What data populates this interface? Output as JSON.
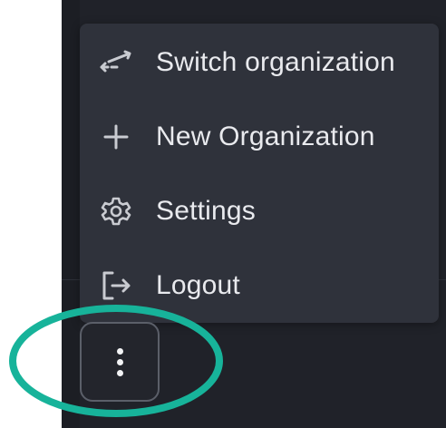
{
  "menu": {
    "items": [
      {
        "label": "Switch organization",
        "icon": "switch-arrows-icon"
      },
      {
        "label": "New Organization",
        "icon": "plus-icon"
      },
      {
        "label": "Settings",
        "icon": "gear-icon"
      },
      {
        "label": "Logout",
        "icon": "logout-icon"
      }
    ]
  },
  "trigger": {
    "icon": "vertical-ellipsis-icon"
  },
  "annotation": {
    "shape": "ellipse",
    "color": "#17b39a"
  },
  "colors": {
    "panel_bg": "#202229",
    "menu_bg": "#2f323b",
    "text": "#e9eaee",
    "icon": "#c9cbd1",
    "highlight": "#17b39a"
  }
}
